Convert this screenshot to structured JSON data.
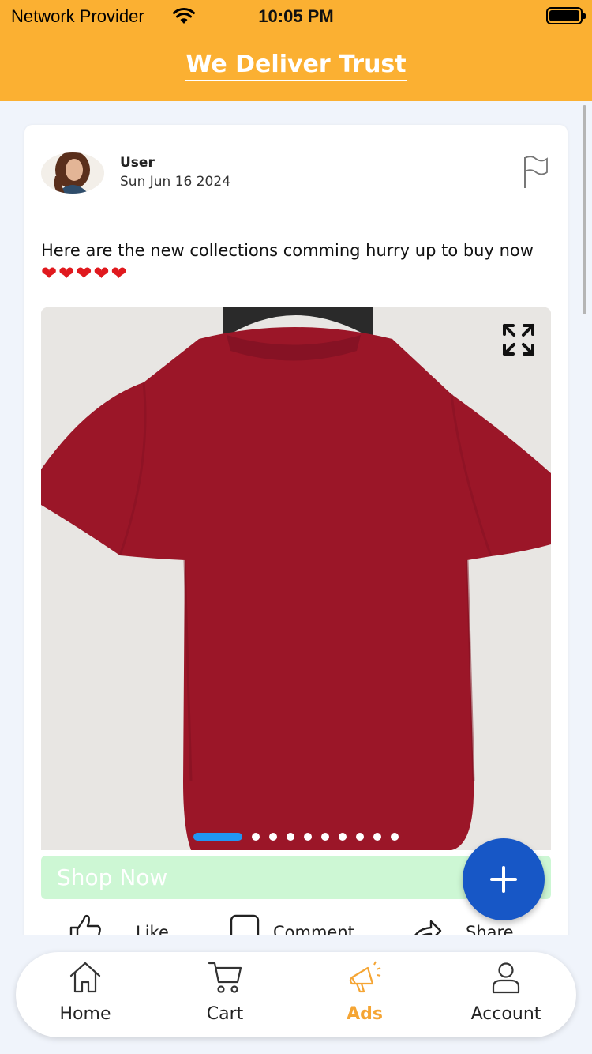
{
  "status_bar": {
    "provider": "Network Provider",
    "time": "10:05 PM"
  },
  "header": {
    "title": "We Deliver Trust"
  },
  "post": {
    "user": "User",
    "date": "Sun Jun 16 2024",
    "text": "Here are the new collections comming hurry up to buy now",
    "hearts": "❤❤❤❤❤",
    "carousel": {
      "total": 10,
      "active_index": 0
    },
    "shop_button": "Shop Now",
    "actions": {
      "like": "Like",
      "comment": "Comment",
      "share": "Share"
    }
  },
  "nav": {
    "items": [
      {
        "label": "Home",
        "icon": "home-icon"
      },
      {
        "label": "Cart",
        "icon": "cart-icon"
      },
      {
        "label": "Ads",
        "icon": "megaphone-icon",
        "active": true
      },
      {
        "label": "Account",
        "icon": "user-icon"
      }
    ]
  },
  "colors": {
    "header_bg": "#fbb032",
    "accent": "#f5a534",
    "fab": "#1757c6",
    "active_dot": "#2196f3",
    "shop_button_bg": "#cdf7d4",
    "shirt": "#9b1628"
  }
}
